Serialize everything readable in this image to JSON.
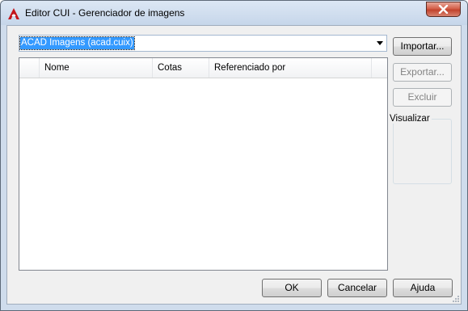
{
  "window": {
    "title": "Editor CUI - Gerenciador de imagens"
  },
  "combo": {
    "selected": "ACAD Imagens (acad.cuix)"
  },
  "list": {
    "columns": [
      "",
      "Nome",
      "Cotas",
      "Referenciado por",
      ""
    ],
    "rows": []
  },
  "buttons": {
    "import": "Importar...",
    "export": "Exportar...",
    "delete": "Excluir",
    "ok": "OK",
    "cancel": "Cancelar",
    "help": "Ajuda"
  },
  "preview": {
    "label": "Visualizar"
  },
  "colors": {
    "accent": "#3399ff",
    "icon_red": "#c4161c"
  },
  "icons": {
    "app": "autocad-a-icon",
    "close": "close-icon",
    "dropdown": "chevron-down-icon"
  }
}
